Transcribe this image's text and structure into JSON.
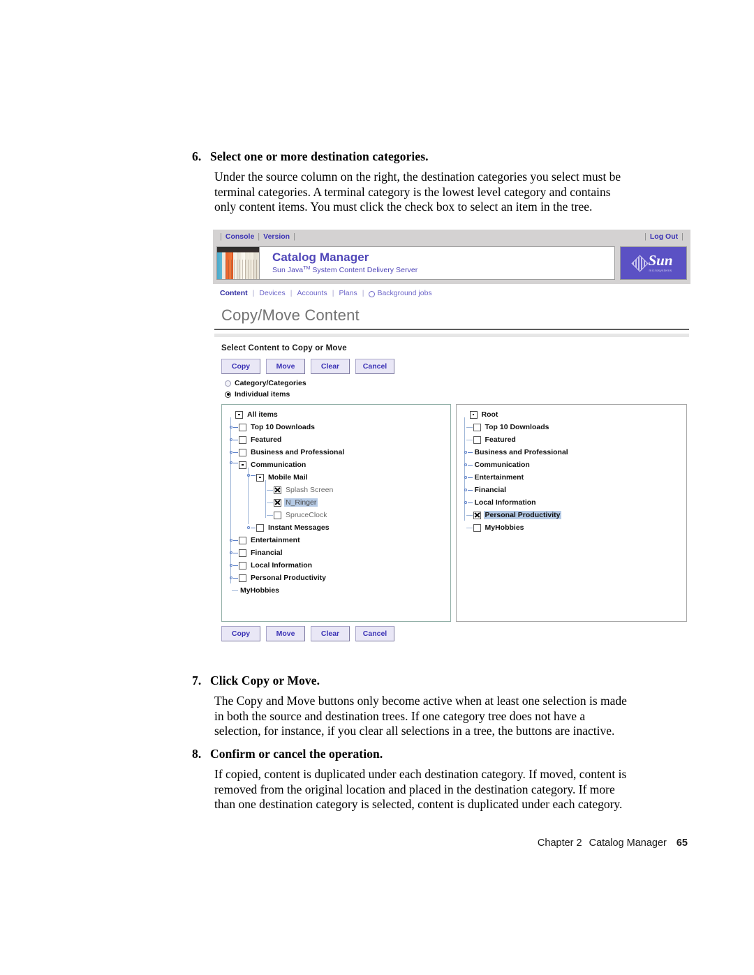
{
  "document": {
    "steps": [
      {
        "number": "6.",
        "heading": "Select one or more destination categories.",
        "lines": [
          "Under the source column on the right, the destination categories you select must be",
          "terminal categories. A terminal category is the lowest level category and contains",
          "only content items. You must click the check box to select an item in the tree."
        ]
      },
      {
        "number": "7.",
        "heading": "Click Copy or Move.",
        "lines": [
          "The Copy and Move buttons only become active when at least one selection is made",
          "in both the source and destination trees. If one category tree does not have a",
          "selection, for instance, if you clear all selections in a tree, the buttons are inactive."
        ]
      },
      {
        "number": "8.",
        "heading": "Confirm or cancel the operation.",
        "lines": [
          "If copied, content is duplicated under each destination category. If moved, content is",
          "removed from the original location and placed in the destination category. If more",
          "than one destination category is selected, content is duplicated under each category."
        ]
      }
    ],
    "footer": {
      "chapter": "Chapter 2",
      "title": "Catalog Manager",
      "page": "65"
    }
  },
  "app": {
    "utility_bar": {
      "console": "Console",
      "version": "Version",
      "logout": "Log Out",
      "separator": "|"
    },
    "banner": {
      "title": "Catalog Manager",
      "subtitle_pre": "Sun Java",
      "subtitle_tm": "TM",
      "subtitle_post": " System Content Delivery Server",
      "logo_word": "Sun",
      "logo_sub": "microsystems",
      "photo_alt": "book-spines-photo"
    },
    "nav": {
      "items": [
        {
          "label": "Content",
          "active": true
        },
        {
          "label": "Devices",
          "active": false
        },
        {
          "label": "Accounts",
          "active": false
        },
        {
          "label": "Plans",
          "active": false
        },
        {
          "label": "Background jobs",
          "active": false,
          "icon": "clock-icon"
        }
      ],
      "separator": "|"
    },
    "page_title": "Copy/Move Content",
    "section_label": "Select Content to Copy or Move",
    "buttons": [
      {
        "label": "Copy",
        "name": "copy-button"
      },
      {
        "label": "Move",
        "name": "move-button"
      },
      {
        "label": "Clear",
        "name": "clear-button"
      },
      {
        "label": "Cancel",
        "name": "cancel-button"
      }
    ],
    "radios": [
      {
        "label": "Category/Categories",
        "selected": false
      },
      {
        "label": "Individual items",
        "selected": true
      }
    ],
    "source_tree": {
      "root_label": "All items",
      "nodes": [
        {
          "label": "All items",
          "depth": 0,
          "icon": "node-box",
          "handle": "none",
          "checkbox": "none",
          "leaf": false,
          "selected": false
        },
        {
          "label": "Top 10 Downloads",
          "depth": 1,
          "icon": "checkbox",
          "handle": "collapsed",
          "checkbox": "unchecked",
          "leaf": false,
          "selected": false
        },
        {
          "label": "Featured",
          "depth": 1,
          "icon": "checkbox",
          "handle": "collapsed",
          "checkbox": "unchecked",
          "leaf": false,
          "selected": false
        },
        {
          "label": "Business and Professional",
          "depth": 1,
          "icon": "checkbox",
          "handle": "collapsed",
          "checkbox": "unchecked",
          "leaf": false,
          "selected": false
        },
        {
          "label": "Communication",
          "depth": 1,
          "icon": "node-box",
          "handle": "expanded",
          "checkbox": "none",
          "leaf": false,
          "selected": false
        },
        {
          "label": "Mobile Mail",
          "depth": 2,
          "icon": "node-box",
          "handle": "expanded",
          "checkbox": "none",
          "leaf": false,
          "selected": false
        },
        {
          "label": "Splash Screen",
          "depth": 3,
          "icon": "checkbox",
          "handle": "stub",
          "checkbox": "checked",
          "leaf": true,
          "selected": false
        },
        {
          "label": "N_Ringer",
          "depth": 3,
          "icon": "checkbox",
          "handle": "stub",
          "checkbox": "checked",
          "leaf": true,
          "selected": true
        },
        {
          "label": "SpruceClock",
          "depth": 3,
          "icon": "checkbox",
          "handle": "stub",
          "checkbox": "unchecked",
          "leaf": true,
          "selected": false
        },
        {
          "label": "Instant Messages",
          "depth": 2,
          "icon": "checkbox",
          "handle": "collapsed",
          "checkbox": "unchecked",
          "leaf": false,
          "selected": false
        },
        {
          "label": "Entertainment",
          "depth": 1,
          "icon": "checkbox",
          "handle": "collapsed",
          "checkbox": "unchecked",
          "leaf": false,
          "selected": false
        },
        {
          "label": "Financial",
          "depth": 1,
          "icon": "checkbox",
          "handle": "collapsed",
          "checkbox": "unchecked",
          "leaf": false,
          "selected": false
        },
        {
          "label": "Local Information",
          "depth": 1,
          "icon": "checkbox",
          "handle": "collapsed",
          "checkbox": "unchecked",
          "leaf": false,
          "selected": false
        },
        {
          "label": "Personal Productivity",
          "depth": 1,
          "icon": "checkbox",
          "handle": "collapsed",
          "checkbox": "unchecked",
          "leaf": false,
          "selected": false
        },
        {
          "label": "MyHobbies",
          "depth": 1,
          "icon": "none",
          "handle": "stub",
          "checkbox": "none",
          "leaf": false,
          "selected": false
        }
      ]
    },
    "destination_tree": {
      "root_label": "Root",
      "nodes": [
        {
          "label": "Root",
          "depth": 0,
          "icon": "node-box",
          "handle": "none",
          "checkbox": "none",
          "leaf": false,
          "selected": false
        },
        {
          "label": "Top 10 Downloads",
          "depth": 1,
          "icon": "checkbox",
          "handle": "stub",
          "checkbox": "unchecked",
          "leaf": false,
          "selected": false
        },
        {
          "label": "Featured",
          "depth": 1,
          "icon": "checkbox",
          "handle": "stub",
          "checkbox": "unchecked",
          "leaf": false,
          "selected": false
        },
        {
          "label": "Business and Professional",
          "depth": 1,
          "icon": "none",
          "handle": "collapsed",
          "checkbox": "none",
          "leaf": false,
          "selected": false
        },
        {
          "label": "Communication",
          "depth": 1,
          "icon": "none",
          "handle": "collapsed",
          "checkbox": "none",
          "leaf": false,
          "selected": false
        },
        {
          "label": "Entertainment",
          "depth": 1,
          "icon": "none",
          "handle": "collapsed",
          "checkbox": "none",
          "leaf": false,
          "selected": false
        },
        {
          "label": "Financial",
          "depth": 1,
          "icon": "none",
          "handle": "collapsed",
          "checkbox": "none",
          "leaf": false,
          "selected": false
        },
        {
          "label": "Local Information",
          "depth": 1,
          "icon": "none",
          "handle": "collapsed",
          "checkbox": "none",
          "leaf": false,
          "selected": false
        },
        {
          "label": "Personal Productivity",
          "depth": 1,
          "icon": "checkbox",
          "handle": "stub",
          "checkbox": "checked",
          "leaf": false,
          "selected": true
        },
        {
          "label": "MyHobbies",
          "depth": 1,
          "icon": "checkbox",
          "handle": "stub",
          "checkbox": "unchecked",
          "leaf": false,
          "selected": false
        }
      ]
    },
    "bottom_buttons": [
      {
        "label": "Copy",
        "name": "copy-button-bottom"
      },
      {
        "label": "Move",
        "name": "move-button-bottom"
      },
      {
        "label": "Clear",
        "name": "clear-button-bottom"
      },
      {
        "label": "Cancel",
        "name": "cancel-button-bottom"
      }
    ],
    "colors": {
      "accent": "#5b51c4",
      "link": "#3b32b5",
      "chrome": "#d4d2d2",
      "selection": "#b6cbe6",
      "button_face": "#e9e7f6"
    }
  }
}
